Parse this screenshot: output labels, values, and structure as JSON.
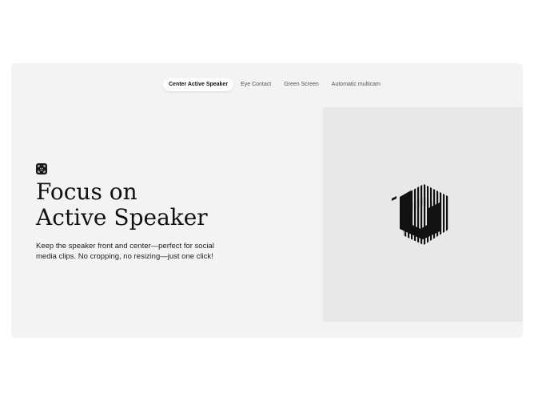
{
  "tabs": [
    {
      "label": "Center Active Speaker",
      "active": true
    },
    {
      "label": "Eye Contact",
      "active": false
    },
    {
      "label": "Green Screen",
      "active": false
    },
    {
      "label": "Automatic multicam",
      "active": false
    }
  ],
  "feature": {
    "icon": "face-frame-icon",
    "headline_line1": "Focus on",
    "headline_line2": "Active Speaker",
    "description": "Keep the speaker front and center—perfect for social media clips. No cropping, no resizing—just one click!"
  },
  "preview": {
    "logo": "striped-hexagon-logo"
  },
  "colors": {
    "page_bg": "#ffffff",
    "card_bg": "#f3f3f3",
    "preview_bg": "#e8e8e8",
    "text": "#111111"
  }
}
